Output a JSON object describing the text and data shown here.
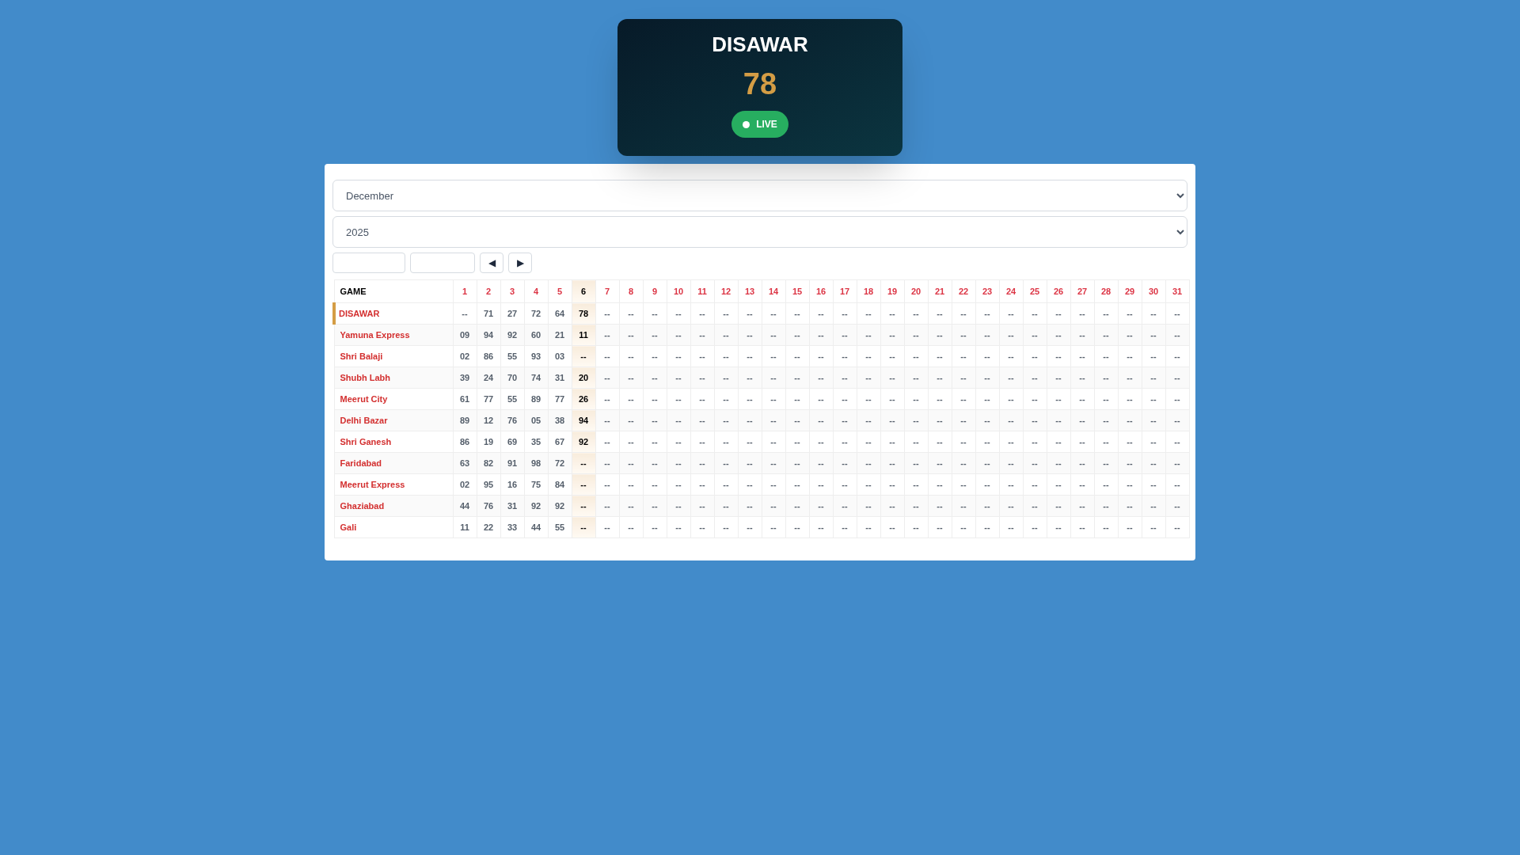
{
  "live_card": {
    "title": "DISAWAR",
    "result": "78",
    "badge": "LIVE"
  },
  "filters": {
    "month": "December",
    "year": "2025",
    "prev_button": "◀",
    "next_button": "▶"
  },
  "table": {
    "game_header": "GAME",
    "days": [
      {
        "label": "1",
        "selected": false
      },
      {
        "label": "2",
        "selected": false
      },
      {
        "label": "3",
        "selected": false
      },
      {
        "label": "4",
        "selected": false
      },
      {
        "label": "5",
        "selected": false
      },
      {
        "label": "6",
        "selected": true
      },
      {
        "label": "7",
        "selected": false
      },
      {
        "label": "8",
        "selected": false
      },
      {
        "label": "9",
        "selected": false
      },
      {
        "label": "10",
        "selected": false
      },
      {
        "label": "11",
        "selected": false
      },
      {
        "label": "12",
        "selected": false
      },
      {
        "label": "13",
        "selected": false
      },
      {
        "label": "14",
        "selected": false
      },
      {
        "label": "15",
        "selected": false
      },
      {
        "label": "16",
        "selected": false
      },
      {
        "label": "17",
        "selected": false
      },
      {
        "label": "18",
        "selected": false
      },
      {
        "label": "19",
        "selected": false
      },
      {
        "label": "20",
        "selected": false
      },
      {
        "label": "21",
        "selected": false
      },
      {
        "label": "22",
        "selected": false
      },
      {
        "label": "23",
        "selected": false
      },
      {
        "label": "24",
        "selected": false
      },
      {
        "label": "25",
        "selected": false
      },
      {
        "label": "26",
        "selected": false
      },
      {
        "label": "27",
        "selected": false
      },
      {
        "label": "28",
        "selected": false
      },
      {
        "label": "29",
        "selected": false
      },
      {
        "label": "30",
        "selected": false
      },
      {
        "label": "31",
        "selected": false
      }
    ],
    "rows": [
      {
        "game": "DISAWAR",
        "selected": true,
        "values": [
          "--",
          "71",
          "27",
          "72",
          "64",
          "78",
          "--",
          "--",
          "--",
          "--",
          "--",
          "--",
          "--",
          "--",
          "--",
          "--",
          "--",
          "--",
          "--",
          "--",
          "--",
          "--",
          "--",
          "--",
          "--",
          "--",
          "--",
          "--",
          "--",
          "--",
          "--"
        ]
      },
      {
        "game": "Yamuna Express",
        "selected": false,
        "values": [
          "09",
          "94",
          "92",
          "60",
          "21",
          "11",
          "--",
          "--",
          "--",
          "--",
          "--",
          "--",
          "--",
          "--",
          "--",
          "--",
          "--",
          "--",
          "--",
          "--",
          "--",
          "--",
          "--",
          "--",
          "--",
          "--",
          "--",
          "--",
          "--",
          "--",
          "--"
        ]
      },
      {
        "game": "Shri Balaji",
        "selected": false,
        "values": [
          "02",
          "86",
          "55",
          "93",
          "03",
          "--",
          "--",
          "--",
          "--",
          "--",
          "--",
          "--",
          "--",
          "--",
          "--",
          "--",
          "--",
          "--",
          "--",
          "--",
          "--",
          "--",
          "--",
          "--",
          "--",
          "--",
          "--",
          "--",
          "--",
          "--",
          "--"
        ]
      },
      {
        "game": "Shubh Labh",
        "selected": false,
        "values": [
          "39",
          "24",
          "70",
          "74",
          "31",
          "20",
          "--",
          "--",
          "--",
          "--",
          "--",
          "--",
          "--",
          "--",
          "--",
          "--",
          "--",
          "--",
          "--",
          "--",
          "--",
          "--",
          "--",
          "--",
          "--",
          "--",
          "--",
          "--",
          "--",
          "--",
          "--"
        ]
      },
      {
        "game": "Meerut City",
        "selected": false,
        "values": [
          "61",
          "77",
          "55",
          "89",
          "77",
          "26",
          "--",
          "--",
          "--",
          "--",
          "--",
          "--",
          "--",
          "--",
          "--",
          "--",
          "--",
          "--",
          "--",
          "--",
          "--",
          "--",
          "--",
          "--",
          "--",
          "--",
          "--",
          "--",
          "--",
          "--",
          "--"
        ]
      },
      {
        "game": "Delhi Bazar",
        "selected": false,
        "values": [
          "89",
          "12",
          "76",
          "05",
          "38",
          "94",
          "--",
          "--",
          "--",
          "--",
          "--",
          "--",
          "--",
          "--",
          "--",
          "--",
          "--",
          "--",
          "--",
          "--",
          "--",
          "--",
          "--",
          "--",
          "--",
          "--",
          "--",
          "--",
          "--",
          "--",
          "--"
        ]
      },
      {
        "game": "Shri Ganesh",
        "selected": false,
        "values": [
          "86",
          "19",
          "69",
          "35",
          "67",
          "92",
          "--",
          "--",
          "--",
          "--",
          "--",
          "--",
          "--",
          "--",
          "--",
          "--",
          "--",
          "--",
          "--",
          "--",
          "--",
          "--",
          "--",
          "--",
          "--",
          "--",
          "--",
          "--",
          "--",
          "--",
          "--"
        ]
      },
      {
        "game": "Faridabad",
        "selected": false,
        "values": [
          "63",
          "82",
          "91",
          "98",
          "72",
          "--",
          "--",
          "--",
          "--",
          "--",
          "--",
          "--",
          "--",
          "--",
          "--",
          "--",
          "--",
          "--",
          "--",
          "--",
          "--",
          "--",
          "--",
          "--",
          "--",
          "--",
          "--",
          "--",
          "--",
          "--",
          "--"
        ]
      },
      {
        "game": "Meerut Express",
        "selected": false,
        "values": [
          "02",
          "95",
          "16",
          "75",
          "84",
          "--",
          "--",
          "--",
          "--",
          "--",
          "--",
          "--",
          "--",
          "--",
          "--",
          "--",
          "--",
          "--",
          "--",
          "--",
          "--",
          "--",
          "--",
          "--",
          "--",
          "--",
          "--",
          "--",
          "--",
          "--",
          "--"
        ]
      },
      {
        "game": "Ghaziabad",
        "selected": false,
        "values": [
          "44",
          "76",
          "31",
          "92",
          "92",
          "--",
          "--",
          "--",
          "--",
          "--",
          "--",
          "--",
          "--",
          "--",
          "--",
          "--",
          "--",
          "--",
          "--",
          "--",
          "--",
          "--",
          "--",
          "--",
          "--",
          "--",
          "--",
          "--",
          "--",
          "--",
          "--"
        ]
      },
      {
        "game": "Gali",
        "selected": false,
        "values": [
          "11",
          "22",
          "33",
          "44",
          "55",
          "--",
          "--",
          "--",
          "--",
          "--",
          "--",
          "--",
          "--",
          "--",
          "--",
          "--",
          "--",
          "--",
          "--",
          "--",
          "--",
          "--",
          "--",
          "--",
          "--",
          "--",
          "--",
          "--",
          "--",
          "--",
          "--"
        ]
      }
    ]
  }
}
